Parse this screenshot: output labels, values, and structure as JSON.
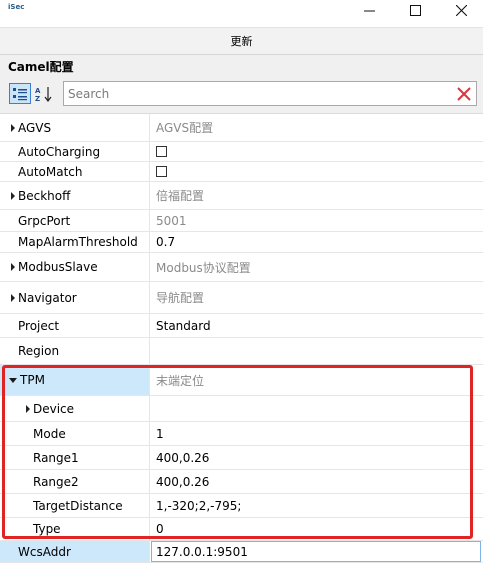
{
  "window": {
    "app_icon_text": "iSec"
  },
  "toolbar": {
    "update_label": "更新"
  },
  "panel": {
    "title": "Camel配置"
  },
  "search": {
    "placeholder": "Search",
    "value": ""
  },
  "properties": [
    {
      "name": "AGVS",
      "value": "AGVS配置",
      "expandable": true
    },
    {
      "name": "AutoCharging",
      "value": "",
      "checkbox": true
    },
    {
      "name": "AutoMatch",
      "value": "",
      "checkbox": true
    },
    {
      "name": "Beckhoff",
      "value": "倍福配置",
      "expandable": true
    },
    {
      "name": "GrpcPort",
      "value": "5001"
    },
    {
      "name": "MapAlarmThreshold",
      "value": "0.7"
    },
    {
      "name": "ModbusSlave",
      "value": "Modbus协议配置",
      "expandable": true
    },
    {
      "name": "Navigator",
      "value": "导航配置",
      "expandable": true
    },
    {
      "name": "Project",
      "value": "Standard"
    },
    {
      "name": "Region",
      "value": ""
    },
    {
      "name": "TPM",
      "value": "末端定位",
      "expanded": true
    },
    {
      "name": "Device",
      "value": "",
      "expandable": true,
      "child": true
    },
    {
      "name": "Mode",
      "value": "1",
      "child": true
    },
    {
      "name": "Range1",
      "value": "400,0.26",
      "child": true
    },
    {
      "name": "Range2",
      "value": "400,0.26",
      "child": true
    },
    {
      "name": "TargetDistance",
      "value": "1,-320;2,-795;",
      "child": true
    },
    {
      "name": "Type",
      "value": "0",
      "child": true
    },
    {
      "name": "WcsAddr",
      "value": "127.0.0.1:9501"
    }
  ]
}
